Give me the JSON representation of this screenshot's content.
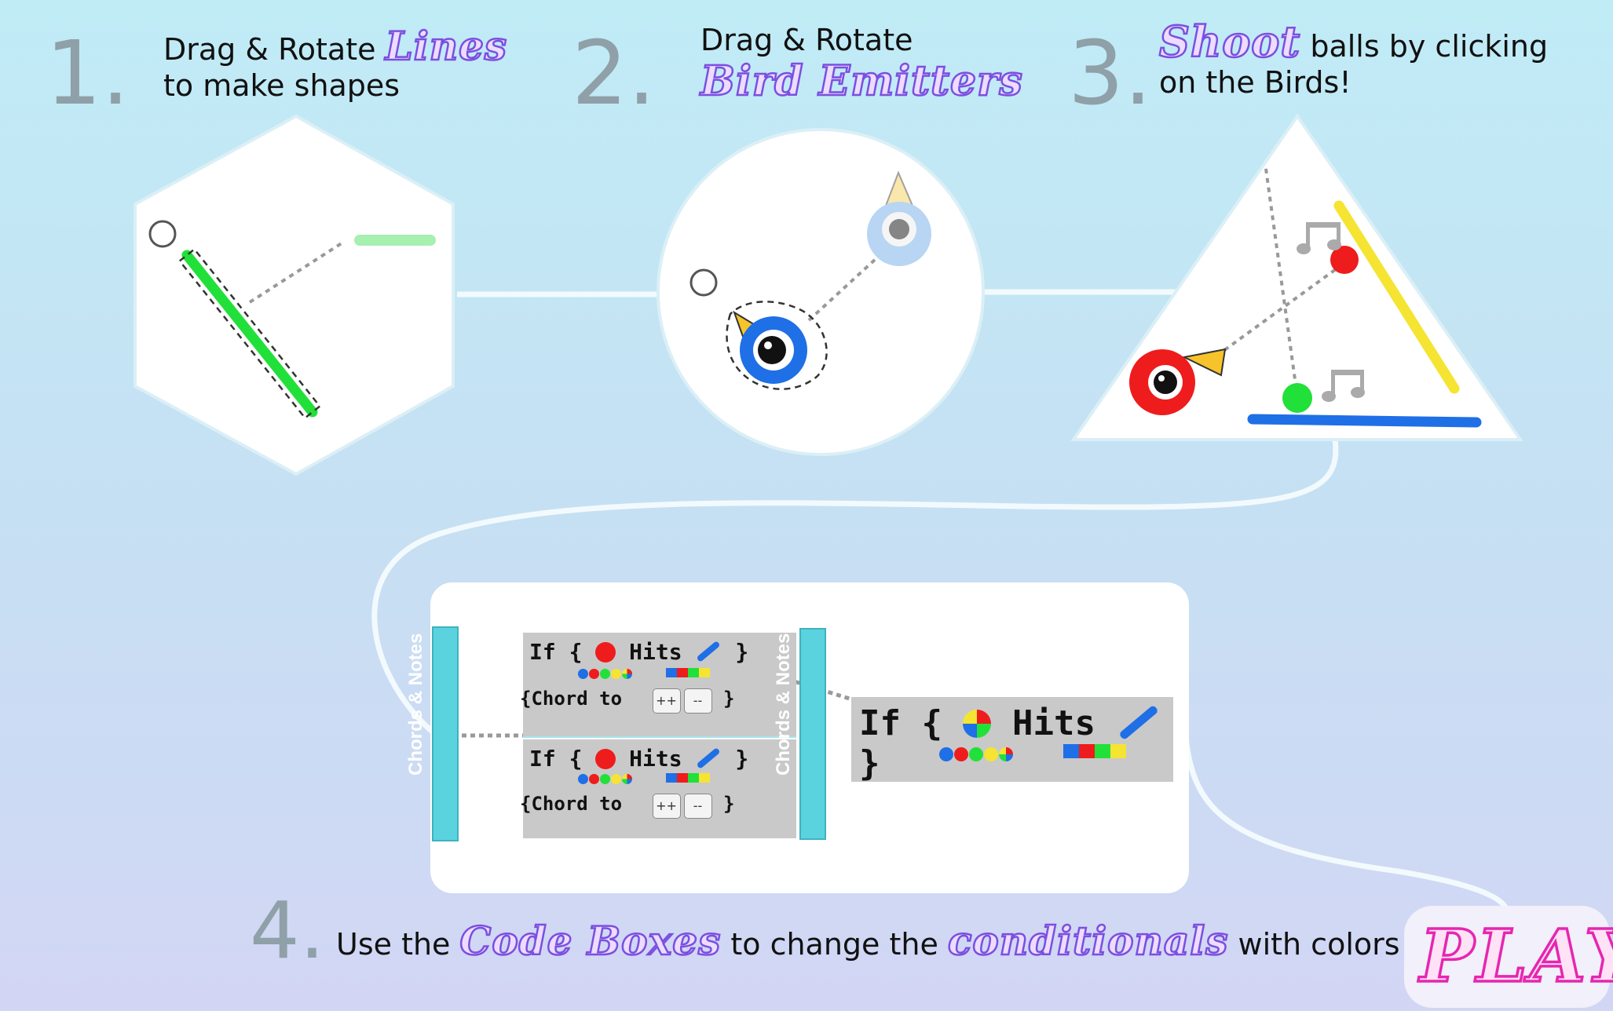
{
  "steps": {
    "one": {
      "number": "1.",
      "prefix": "Drag & Rotate",
      "highlight": "Lines",
      "suffix": "to make shapes"
    },
    "two": {
      "number": "2.",
      "prefix": "Drag & Rotate",
      "highlight": "Bird Emitters"
    },
    "three": {
      "number": "3.",
      "highlight": "Shoot",
      "suffix_a": "balls by clicking",
      "suffix_b": "on the Birds!"
    },
    "four": {
      "number": "4.",
      "prefix": "Use the",
      "highlight_a": "Code Boxes",
      "middle": "to change  the",
      "highlight_b": "conditionals",
      "suffix": "with colors!"
    }
  },
  "code_panel": {
    "tab_label": "Chords & Notes",
    "blocks": [
      {
        "if": "If {",
        "hits": "Hits",
        "close": "}",
        "action": "{Chord to",
        "plus": "++",
        "minus": "--",
        "end": "}"
      },
      {
        "if": "If {",
        "hits": "Hits",
        "close": "}",
        "action": "{Chord to",
        "plus": "++",
        "minus": "--",
        "end": "}"
      }
    ],
    "zoom": {
      "if": "If {",
      "hits": "Hits",
      "close": "}"
    }
  },
  "play_button": {
    "label": "PLAY"
  },
  "icons": [
    "music-note-icon",
    "bird-emitter-icon",
    "ball-icon",
    "line-icon"
  ],
  "colors": {
    "accent_purple": "#7b4fe0",
    "play_pink": "#e626b0",
    "green_line": "#22e03a",
    "yellow_line": "#f5e432",
    "blue_line": "#1f6fe6",
    "red_ball": "#ee1c1c",
    "tab_cyan": "#5bd3df"
  }
}
